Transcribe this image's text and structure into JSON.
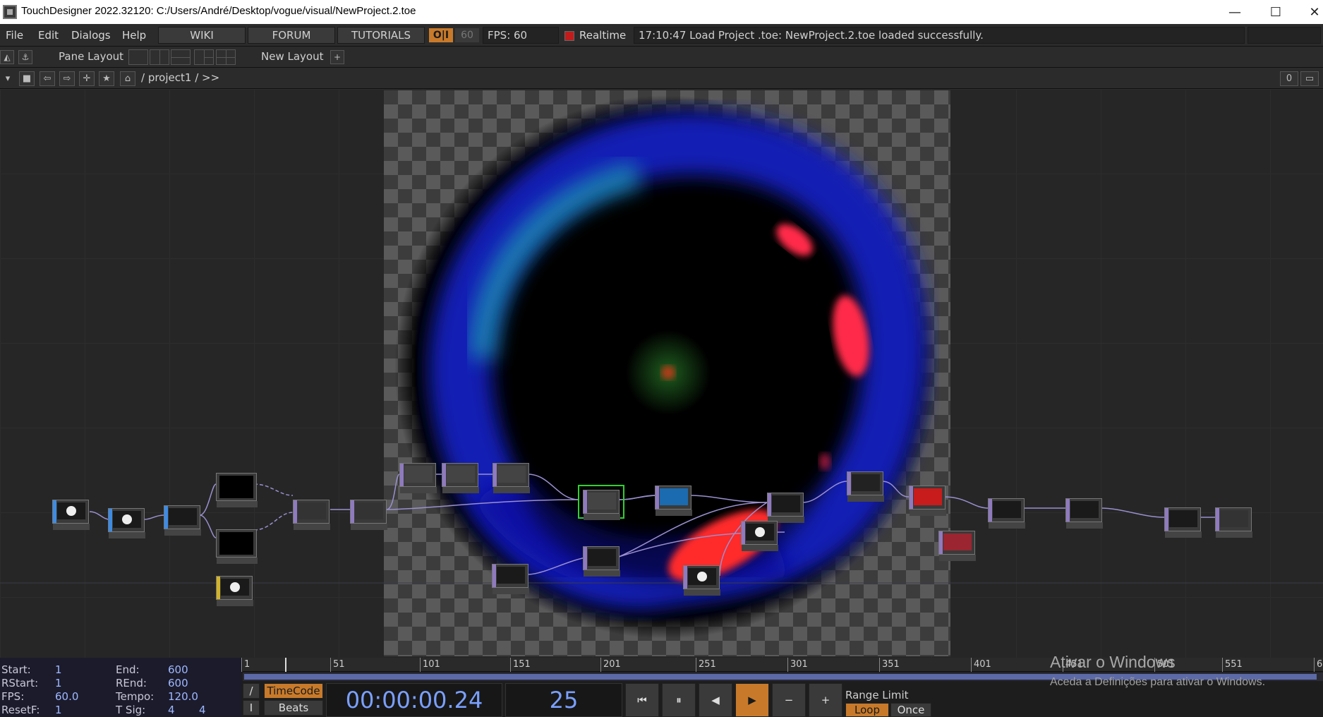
{
  "window": {
    "title": "TouchDesigner 2022.32120: C:/Users/André/Desktop/vogue/visual/NewProject.2.toe",
    "minimize": "—",
    "maximize": "☐",
    "close": "✕"
  },
  "menubar": {
    "items": [
      "File",
      "Edit",
      "Dialogs",
      "Help"
    ],
    "buttons": [
      "WIKI",
      "FORUM",
      "TUTORIALS"
    ],
    "oi": "O|I",
    "target_fps": "60",
    "fps_label": "FPS:  60",
    "realtime_label": "Realtime",
    "status_message": "17:10:47 Load Project .toe: NewProject.2.toe loaded successfully."
  },
  "panebar": {
    "pane_layout_label": "Pane Layout",
    "new_layout_label": "New Layout",
    "add_symbol": "+"
  },
  "pathbar": {
    "path": "/ project1 / >>",
    "counter": "0"
  },
  "timeline": {
    "start_label": "Start:",
    "start_value": "1",
    "rstart_label": "RStart:",
    "rstart_value": "1",
    "fps_label": "FPS:",
    "fps_value": "60.0",
    "resetf_label": "ResetF:",
    "resetf_value": "1",
    "end_label": "End:",
    "end_value": "600",
    "rend_label": "REnd:",
    "rend_value": "600",
    "tempo_label": "Tempo:",
    "tempo_value": "120.0",
    "tsig_label": "T Sig:",
    "tsig_value_a": "4",
    "tsig_value_b": "4",
    "ruler_ticks": [
      "1",
      "51",
      "101",
      "151",
      "201",
      "251",
      "301",
      "351",
      "401",
      "451",
      "501",
      "551",
      "6"
    ],
    "timecode_button": "TimeCode",
    "beats_button": "Beats",
    "timecode": "00:00:00.24",
    "frame": "25",
    "range_limit_label": "Range Limit",
    "loop_button": "Loop",
    "once_button": "Once",
    "slash_button": "/",
    "i_button": "I"
  },
  "watermark": {
    "line1": "Ativar o Windows",
    "line2": "Aceda a Definições para ativar o Windows."
  },
  "colors": {
    "accent_orange": "#c87a2a",
    "realtime_red": "#c21b1b",
    "selected_green": "#2ed12e",
    "timecode_blue": "#7aa0ff"
  }
}
